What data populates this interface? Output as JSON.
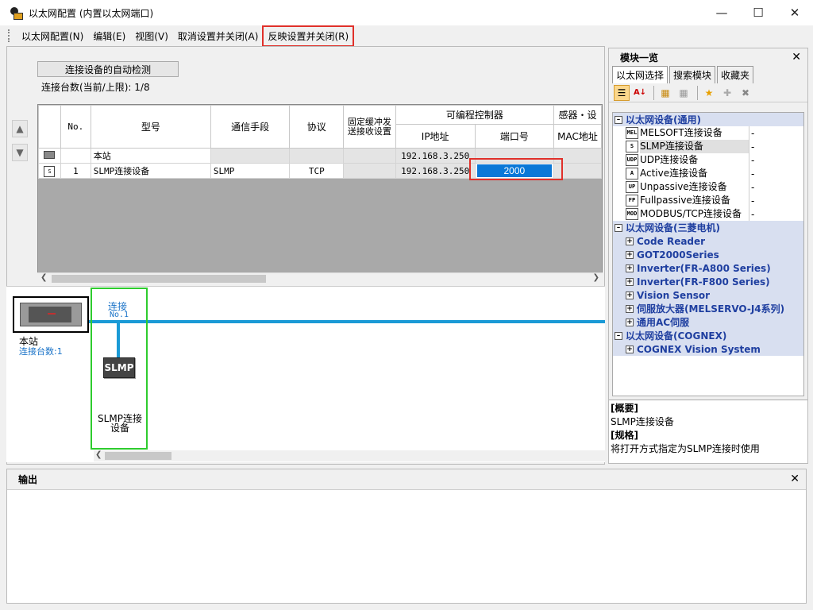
{
  "window": {
    "title": "以太网配置 (内置以太网端口)"
  },
  "menu": [
    "以太网配置(N)",
    "编辑(E)",
    "视图(V)",
    "取消设置并关闭(A)",
    "反映设置并关闭(R)"
  ],
  "top": {
    "autodetect": "连接设备的自动检测",
    "count_label": "连接台数(当前/上限):  1/8"
  },
  "grid": {
    "headers": {
      "no": "No.",
      "model": "型号",
      "comm": "通信手段",
      "protocol": "协议",
      "fixed_buf": "固定缓冲发送接收设置",
      "plc_group": "可编程控制器",
      "ip": "IP地址",
      "port": "端口号",
      "sensor": "感器・设",
      "mac": "MAC地址"
    },
    "rows": [
      {
        "no": "",
        "model": "本站",
        "comm": "",
        "protocol": "",
        "ip": "192.168.3.250",
        "port": ""
      },
      {
        "no": "1",
        "model": "SLMP连接设备",
        "comm": "SLMP",
        "protocol": "TCP",
        "ip": "192.168.3.250",
        "port": "2000"
      }
    ]
  },
  "diagram": {
    "station_name": "本站",
    "station_count": "连接台数:1",
    "conn_label": "连接",
    "conn_no": "No.1",
    "device_icon": "SLMP",
    "device_name": "SLMP连接设备"
  },
  "module_list": {
    "title": "模块一览",
    "tabs": [
      "以太网选择",
      "搜索模块",
      "收藏夹"
    ],
    "categories": [
      {
        "name": "以太网设备(通用)",
        "items": [
          {
            "icon": "MEL",
            "name": "MELSOFT连接设备",
            "val": "-"
          },
          {
            "icon": "S",
            "name": "SLMP连接设备",
            "val": "-"
          },
          {
            "icon": "UDP",
            "name": "UDP连接设备",
            "val": "-"
          },
          {
            "icon": "A",
            "name": "Active连接设备",
            "val": "-"
          },
          {
            "icon": "UP",
            "name": "Unpassive连接设备",
            "val": "-"
          },
          {
            "icon": "FP",
            "name": "Fullpassive连接设备",
            "val": "-"
          },
          {
            "icon": "MOD",
            "name": "MODBUS/TCP连接设备",
            "val": "-"
          }
        ]
      },
      {
        "name": "以太网设备(三菱电机)",
        "subs": [
          "Code Reader",
          "GOT2000Series",
          "Inverter(FR-A800 Series)",
          "Inverter(FR-F800 Series)",
          "Vision Sensor",
          "伺服放大器(MELSERVO-J4系列)",
          "通用AC伺服"
        ]
      },
      {
        "name": "以太网设备(COGNEX)",
        "subs": [
          "COGNEX Vision System"
        ]
      }
    ],
    "desc": {
      "overview_label": "[概要]",
      "overview": "SLMP连接设备",
      "spec_label": "[规格]",
      "spec": "将打开方式指定为SLMP连接时使用"
    }
  },
  "output": {
    "title": "输出"
  },
  "colors": {
    "accent": "#0a78d7",
    "highlight": "#e0302a",
    "bus": "#1a9ad6",
    "selection_green": "#2ecc2e"
  }
}
